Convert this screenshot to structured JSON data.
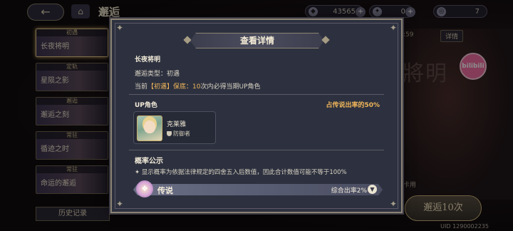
{
  "header": {
    "title": "邂逅",
    "back_icon": "←",
    "currencies": [
      {
        "name": "diamond",
        "value": "43565"
      },
      {
        "name": "ticket",
        "value": "0"
      },
      {
        "name": "special-ticket",
        "value": "7"
      }
    ]
  },
  "banners": [
    {
      "tag": "初遇",
      "name": "长夜将明",
      "active": true
    },
    {
      "tag": "定轨",
      "name": "星陨之影",
      "active": false
    },
    {
      "tag": "邂逅",
      "name": "邂逅之刻",
      "active": false
    },
    {
      "tag": "常驻",
      "name": "循迹之时",
      "active": false
    },
    {
      "tag": "常驻",
      "name": "命运的邂逅",
      "active": false
    }
  ],
  "history_label": "历史记录",
  "right_panel": {
    "timer": ":59",
    "detail_label": "详情",
    "art_title": "將明",
    "bili_label": "bilibili",
    "side_label": "卡用",
    "pull10_label": "邂逅10次"
  },
  "uid": "UID 1290002235",
  "modal": {
    "title": "查看详情",
    "pool_name": "长夜将明",
    "pool_type": "邂逅类型：初遇",
    "pity_prefix": "当前",
    "pity_tag": "【初遇】保底：",
    "pity_count": "10",
    "pity_suffix": "次内必得当期UP角色",
    "up_title": "UP角色",
    "up_rate": "占传说出率的50%",
    "character": {
      "name": "克莱雅",
      "role": "防御者"
    },
    "prob_title": "概率公示",
    "prob_note": "✦ 显示概率为依据法律规定的四舍五入后数值，因此合计数值可能不等于100%",
    "rarity": {
      "label": "传说",
      "rate": "综合出率2%"
    }
  }
}
